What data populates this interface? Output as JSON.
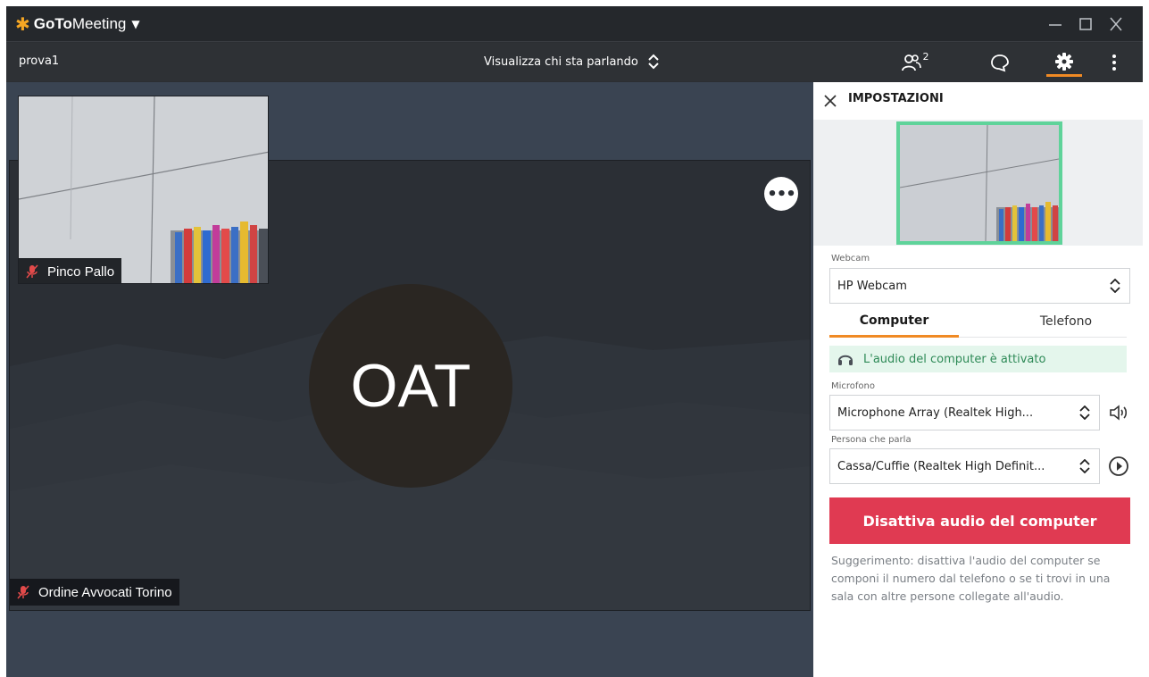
{
  "app": {
    "brand_bold": "GoTo",
    "brand_light": "Meeting"
  },
  "toolbar": {
    "meeting_name": "prova1",
    "view_mode": "Visualizza chi sta parlando",
    "attendee_count": "2"
  },
  "stage": {
    "main_avatar_initials": "OAT",
    "main_participant": "Ordine Avvocati Torino",
    "thumb_participant": "Pinco Pallo"
  },
  "settings": {
    "title": "IMPOSTAZIONI",
    "webcam_label": "Webcam",
    "webcam_value": "HP Webcam",
    "tabs": [
      {
        "label": "Computer",
        "active": true
      },
      {
        "label": "Telefono",
        "active": false
      }
    ],
    "audio_status": "L'audio del computer è attivato",
    "mic_label": "Microfono",
    "mic_value": "Microphone Array (Realtek High...",
    "speaker_label": "Persona che parla",
    "speaker_value": "Cassa/Cuffie (Realtek High Definit...",
    "mute_button": "Disattiva audio del computer",
    "hint": "Suggerimento: disattiva l'audio del computer se componi il numero dal telefono o se ti trovi in una sala con altre persone collegate all'audio."
  },
  "colors": {
    "accent": "#f08a24",
    "danger": "#e03a52",
    "success_bg": "#e4f6ec",
    "success_text": "#2e8a57",
    "preview_border": "#5fd39a"
  },
  "icons": {
    "logo": "asterisk-burst-icon",
    "view_mode": "up-down-chevron-icon",
    "attendees": "people-icon",
    "chat": "chat-bubble-icon",
    "settings": "gear-icon",
    "more": "vertical-dots-icon",
    "close": "close-icon",
    "mic_muted": "mic-muted-icon",
    "audio": "headphones-icon",
    "speaker_test": "speaker-icon",
    "play": "play-circle-icon"
  }
}
